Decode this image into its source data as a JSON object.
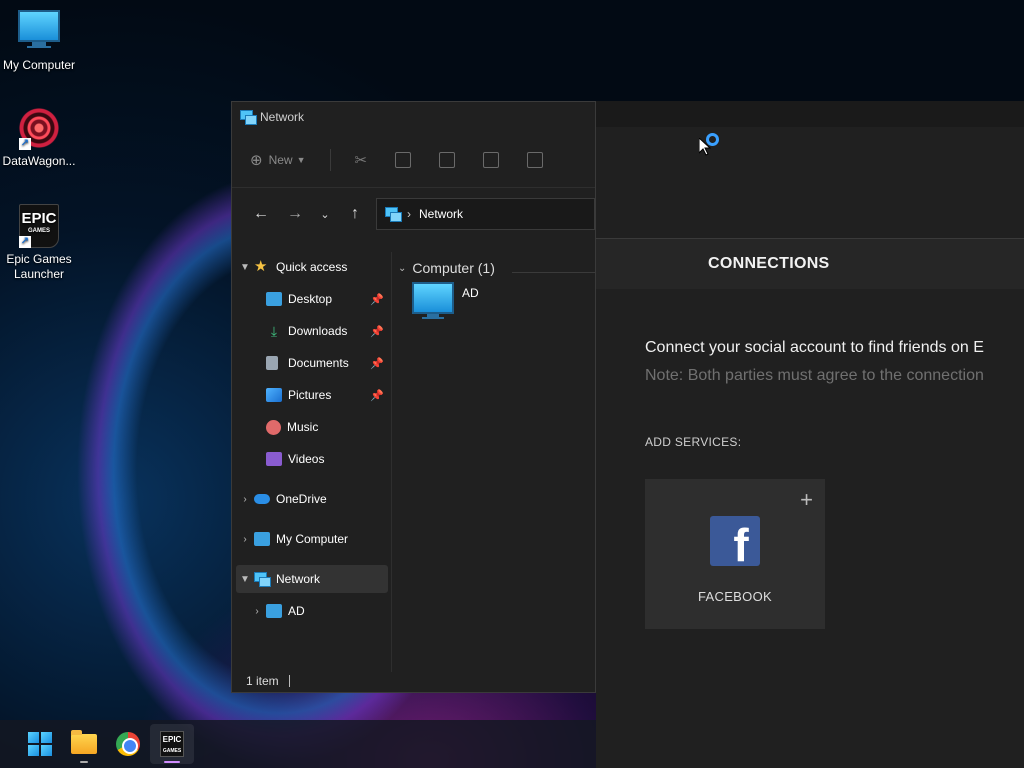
{
  "desktop": {
    "icons": [
      {
        "label": "My Computer"
      },
      {
        "label": "DataWagon..."
      },
      {
        "label": "Epic Games Launcher"
      }
    ],
    "epic_logo_text": "EPIC",
    "epic_logo_sub": "GAMES"
  },
  "explorer": {
    "title": "Network",
    "toolbar": {
      "new_label": "New"
    },
    "address": {
      "path": "Network"
    },
    "nav": {
      "quick_access": "Quick access",
      "desktop": "Desktop",
      "downloads": "Downloads",
      "documents": "Documents",
      "pictures": "Pictures",
      "music": "Music",
      "videos": "Videos",
      "onedrive": "OneDrive",
      "my_computer": "My Computer",
      "network": "Network",
      "ad": "AD"
    },
    "content": {
      "group_header": "Computer (1)",
      "items": [
        {
          "label": "AD"
        }
      ]
    },
    "status": "1 item"
  },
  "epic": {
    "tab": "CONNECTIONS",
    "connect_text": "Connect your social account to find friends on E",
    "note_text": "Note: Both parties must agree to the connection",
    "add_services": "ADD SERVICES:",
    "service": {
      "label": "FACEBOOK",
      "plus": "+",
      "logo": "f"
    }
  },
  "taskbar": {
    "epic_text": "EPIC",
    "epic_sub": "GAMES"
  }
}
